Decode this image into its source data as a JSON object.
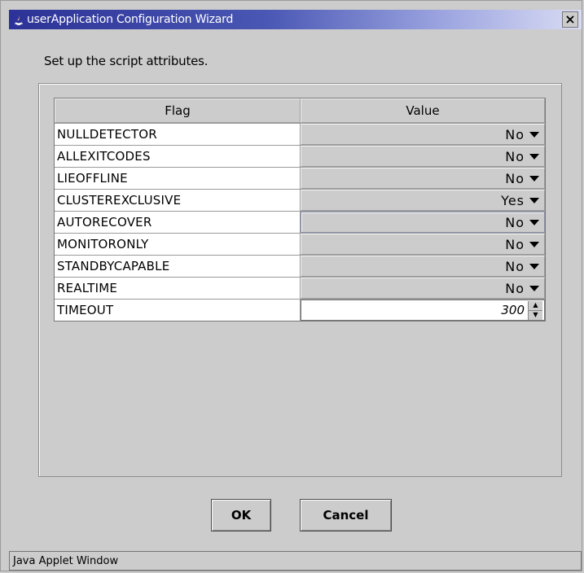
{
  "window": {
    "title": "userApplication Configuration Wizard",
    "close_symbol": "×",
    "icon": "java-cup-icon"
  },
  "prompt": "Set up the script attributes.",
  "table": {
    "headers": [
      "Flag",
      "Value"
    ],
    "rows": [
      {
        "flag": "NULLDETECTOR",
        "value": "No"
      },
      {
        "flag": "ALLEXITCODES",
        "value": "No"
      },
      {
        "flag": "LIEOFFLINE",
        "value": "No"
      },
      {
        "flag": "CLUSTEREXCLUSIVE",
        "value": "Yes"
      },
      {
        "flag": "AUTORECOVER",
        "value": "No"
      },
      {
        "flag": "MONITORONLY",
        "value": "No"
      },
      {
        "flag": "STANDBYCAPABLE",
        "value": "No"
      },
      {
        "flag": "REALTIME",
        "value": "No"
      }
    ],
    "timeout": {
      "flag": "TIMEOUT",
      "value": "300"
    }
  },
  "buttons": {
    "ok": "OK",
    "cancel": "Cancel"
  },
  "status": "Java Applet Window"
}
